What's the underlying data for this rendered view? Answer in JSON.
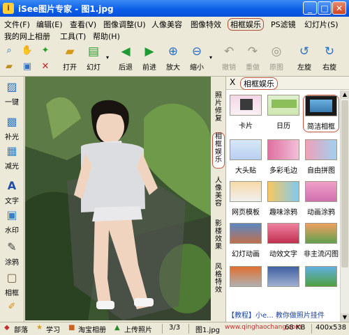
{
  "window": {
    "title": "iSee图片专家 - 图1.jpg",
    "app_icon": "photo-app-icon"
  },
  "menubar": {
    "items": [
      "文件(F)",
      "编辑(E)",
      "查看(V)",
      "图像调整(U)",
      "人像美容",
      "图像特效",
      "相框娱乐",
      "PS滤镜",
      "幻灯片(S)"
    ],
    "items_row2": [
      "我的网上相册",
      "工具(T)",
      "帮助(H)"
    ],
    "active": "相框娱乐"
  },
  "toolbar": {
    "buttons": [
      {
        "label": "打开",
        "icon": "folder-open-icon",
        "enabled": true
      },
      {
        "label": "幻灯",
        "icon": "slideshow-icon",
        "enabled": true
      },
      {
        "label": "后退",
        "icon": "arrow-left-icon",
        "enabled": true
      },
      {
        "label": "前进",
        "icon": "arrow-right-icon",
        "enabled": true
      },
      {
        "label": "放大",
        "icon": "zoom-in-icon",
        "enabled": true
      },
      {
        "label": "缩小",
        "icon": "zoom-out-icon",
        "enabled": true
      },
      {
        "label": "撤销",
        "icon": "undo-icon",
        "enabled": false
      },
      {
        "label": "重做",
        "icon": "redo-icon",
        "enabled": false
      },
      {
        "label": "原图",
        "icon": "original-icon",
        "enabled": false
      },
      {
        "label": "左旋",
        "icon": "rotate-left-icon",
        "enabled": true
      },
      {
        "label": "右旋",
        "icon": "rotate-right-icon",
        "enabled": true
      }
    ]
  },
  "left_tools": [
    {
      "label": "一键",
      "icon": "one-click-icon"
    },
    {
      "label": "补光",
      "icon": "fill-light-icon"
    },
    {
      "label": "减光",
      "icon": "reduce-light-icon"
    },
    {
      "label": "文字",
      "icon": "text-icon"
    },
    {
      "label": "水印",
      "icon": "watermark-icon"
    },
    {
      "label": "涂鸦",
      "icon": "doodle-icon"
    },
    {
      "label": "相框",
      "icon": "frame-icon"
    }
  ],
  "side_tabs": [
    {
      "label": "照片修复",
      "active": false
    },
    {
      "label": "相框娱乐",
      "active": true
    },
    {
      "label": "人像美容",
      "active": false
    },
    {
      "label": "影楼效果",
      "active": false
    },
    {
      "label": "风格特效",
      "active": false
    }
  ],
  "panel": {
    "title": "相框娱乐",
    "close_glyph": "X",
    "items": [
      {
        "label": "卡片",
        "selected": false
      },
      {
        "label": "日历",
        "selected": false
      },
      {
        "label": "简洁相框",
        "selected": true
      },
      {
        "label": "大头贴",
        "selected": false
      },
      {
        "label": "多彩毛边",
        "selected": false
      },
      {
        "label": "自由拼图",
        "selected": false
      },
      {
        "label": "网页模板",
        "selected": false
      },
      {
        "label": "趣味涂鸦",
        "selected": false
      },
      {
        "label": "动画涂鸦",
        "selected": false
      },
      {
        "label": "幻灯动画",
        "selected": false
      },
      {
        "label": "动效文字",
        "selected": false
      },
      {
        "label": "非主流闪图",
        "selected": false
      },
      {
        "label": "",
        "selected": false
      },
      {
        "label": "",
        "selected": false
      },
      {
        "label": "",
        "selected": false
      }
    ],
    "footer_text": "【教程】小e... 教你做照片挂件"
  },
  "statusbar": {
    "items": [
      "部落",
      "学习",
      "淘宝相册",
      "上传照片"
    ],
    "page": "3/3",
    "filename": "图1.jpg",
    "filesize": "68 KB",
    "dimensions": "400x538"
  },
  "watermark": "www.qinghaochang.com"
}
